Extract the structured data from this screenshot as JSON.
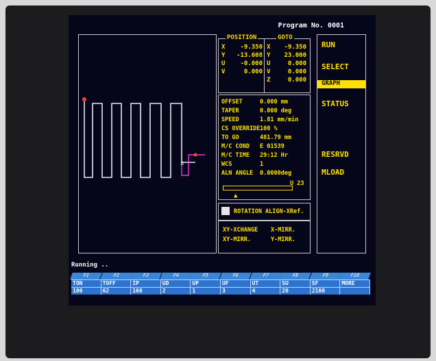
{
  "header": {
    "program": "Program No. 0001"
  },
  "position": {
    "title": "POSITION",
    "rows": [
      {
        "axis": "X",
        "value": "-9.350"
      },
      {
        "axis": "Y",
        "value": "-13.608"
      },
      {
        "axis": "U",
        "value": "-0.000"
      },
      {
        "axis": "V",
        "value": "0.000"
      }
    ]
  },
  "goto": {
    "title": "GOTO",
    "rows": [
      {
        "axis": "X",
        "value": "-9.350"
      },
      {
        "axis": "Y",
        "value": "23.000"
      },
      {
        "axis": "U",
        "value": "0.000"
      },
      {
        "axis": "V",
        "value": "0.000"
      },
      {
        "axis": "Z",
        "value": "0.000"
      }
    ]
  },
  "params": [
    {
      "label": "OFFSET",
      "value": "0.000 mm"
    },
    {
      "label": "TAPER",
      "value": "0.000 deg"
    },
    {
      "label": "SPEED",
      "value": "1.81 mm/min"
    },
    {
      "label": "CS OVERRIDE",
      "value": "100 %"
    },
    {
      "label": "TO GO",
      "value": "481.79 mm"
    },
    {
      "label": "M/C COND",
      "value": "E 01539"
    },
    {
      "label": "M/C TIME",
      "value": "29:12 Hr"
    },
    {
      "label": "WCS",
      "value": "1"
    },
    {
      "label": "ALN ANGLE",
      "value": "0.0000deg"
    }
  ],
  "slider": {
    "label": "U 23"
  },
  "rotation": {
    "label": "ROTATION ALIGN-XRef."
  },
  "mirror": {
    "xy_xchange": "XY-XCHANGE",
    "x_mirr": "X-MIRR.",
    "xy_mirr": "XY-MIRR.",
    "y_mirr": "Y-MIRR."
  },
  "menu": {
    "run": "RUN",
    "select": "SELECT",
    "graph": "GRAPH",
    "status": "STATUS",
    "resrvd": "RESRVD",
    "mload": "MLOAD"
  },
  "status_text": "Running ..",
  "fkeys": [
    "F1",
    "F2",
    "F3",
    "F4",
    "F5",
    "F6",
    "F7",
    "F8",
    "F9",
    "F10"
  ],
  "table": {
    "headers": [
      "TON",
      "TOFF",
      "IP",
      "UD",
      "UP",
      "UF",
      "UT",
      "SU",
      "SF",
      "MORE"
    ],
    "values": [
      "100",
      "62",
      "160",
      "2",
      "1",
      "3",
      "4",
      "20",
      "2100",
      ""
    ]
  },
  "colors": {
    "accent": "#ffe100",
    "screen": "#06061a",
    "key": "#2c74d0"
  }
}
